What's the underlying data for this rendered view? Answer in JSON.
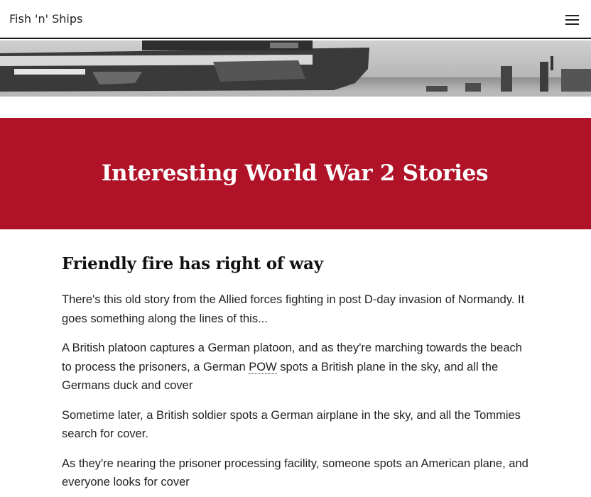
{
  "header": {
    "site_title": "Fish 'n' Ships",
    "menu_icon": "hamburger-menu-icon"
  },
  "hero": {
    "title": "Interesting World War 2 Stories",
    "background_color": "#b01328"
  },
  "article": {
    "heading": "Friendly fire has right of way",
    "paragraph_1": "There's this old story from the Allied forces fighting in post D-day invasion of Normandy. It goes something along the lines of this...",
    "paragraph_2_before": "A British platoon captures a German platoon, and as they're marching towards the beach to process the prisoners, a German ",
    "paragraph_2_abbr": "POW",
    "paragraph_2_after": " spots a British plane in the sky, and all the Germans duck and cover",
    "paragraph_3": "Sometime later, a British soldier spots a German airplane in the sky, and all the Tommies search for cover.",
    "paragraph_4": "As they're nearing the prisoner processing facility, someone spots an American plane, and everyone looks for cover"
  }
}
